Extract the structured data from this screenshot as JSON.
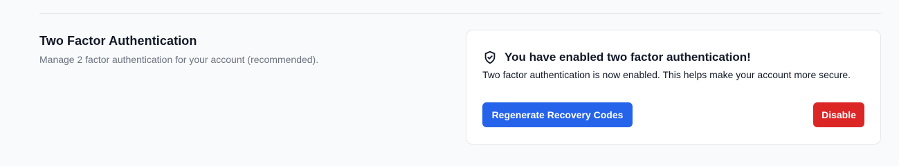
{
  "section": {
    "title": "Two Factor Authentication",
    "description": "Manage 2 factor authentication for your account (recommended)."
  },
  "card": {
    "icon": "shield-check-icon",
    "title": "You have enabled two factor authentication!",
    "text": "Two factor authentication is now enabled. This helps make your account more secure.",
    "regenerate_label": "Regenerate Recovery Codes",
    "disable_label": "Disable"
  },
  "colors": {
    "primary": "#2563eb",
    "danger": "#dc2626",
    "background": "#f9fafb",
    "card": "#ffffff",
    "muted_text": "#6b7280"
  }
}
